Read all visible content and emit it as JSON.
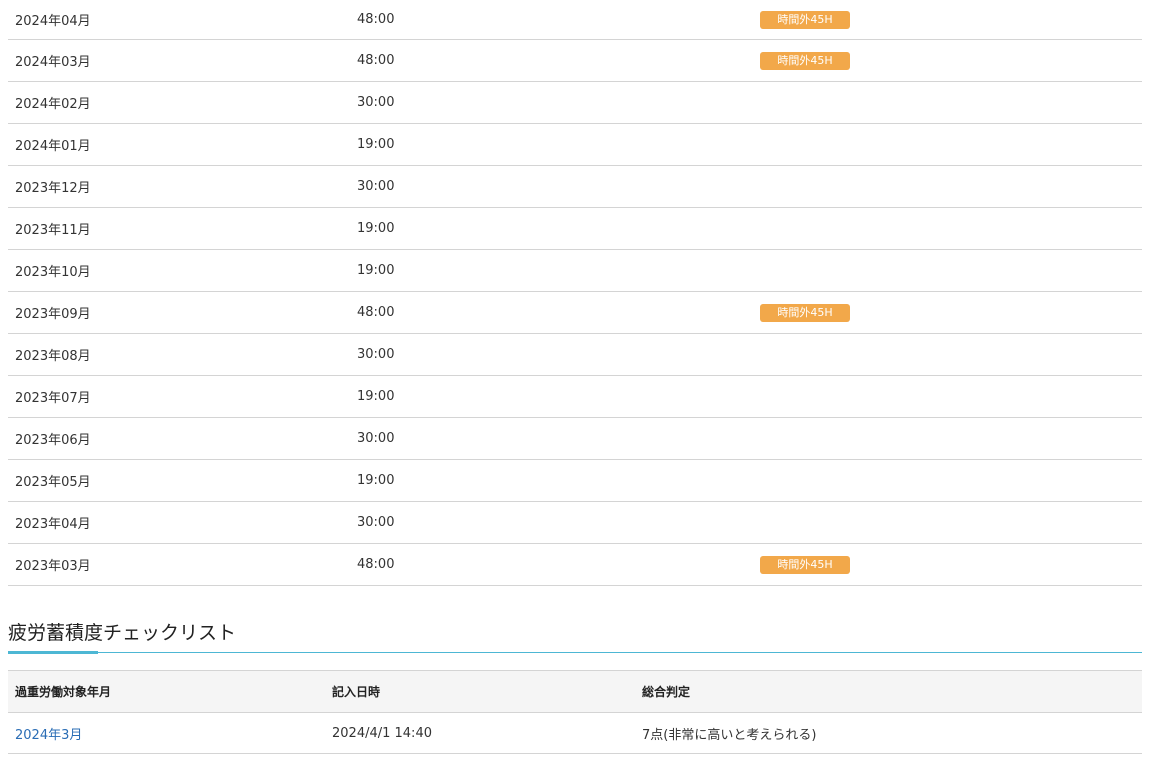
{
  "overtime_rows": [
    {
      "month": "2024年04月",
      "hours": "48:00",
      "badge": "時間外45H"
    },
    {
      "month": "2024年03月",
      "hours": "48:00",
      "badge": "時間外45H"
    },
    {
      "month": "2024年02月",
      "hours": "30:00",
      "badge": ""
    },
    {
      "month": "2024年01月",
      "hours": "19:00",
      "badge": ""
    },
    {
      "month": "2023年12月",
      "hours": "30:00",
      "badge": ""
    },
    {
      "month": "2023年11月",
      "hours": "19:00",
      "badge": ""
    },
    {
      "month": "2023年10月",
      "hours": "19:00",
      "badge": ""
    },
    {
      "month": "2023年09月",
      "hours": "48:00",
      "badge": "時間外45H"
    },
    {
      "month": "2023年08月",
      "hours": "30:00",
      "badge": ""
    },
    {
      "month": "2023年07月",
      "hours": "19:00",
      "badge": ""
    },
    {
      "month": "2023年06月",
      "hours": "30:00",
      "badge": ""
    },
    {
      "month": "2023年05月",
      "hours": "19:00",
      "badge": ""
    },
    {
      "month": "2023年04月",
      "hours": "30:00",
      "badge": ""
    },
    {
      "month": "2023年03月",
      "hours": "48:00",
      "badge": "時間外45H"
    }
  ],
  "checklist": {
    "title": "疲労蓄積度チェックリスト",
    "headers": {
      "target_month": "過重労働対象年月",
      "entry_datetime": "記入日時",
      "overall_judgment": "総合判定"
    },
    "rows": [
      {
        "target_month": "2024年3月",
        "entry_datetime": "2024/4/1 14:40",
        "overall_judgment": "7点(非常に高いと考えられる)"
      }
    ]
  },
  "colors": {
    "badge": "#f2a84a",
    "accent": "#4db7d4",
    "link": "#2a6db5",
    "header_bg": "#f5f5f5"
  }
}
